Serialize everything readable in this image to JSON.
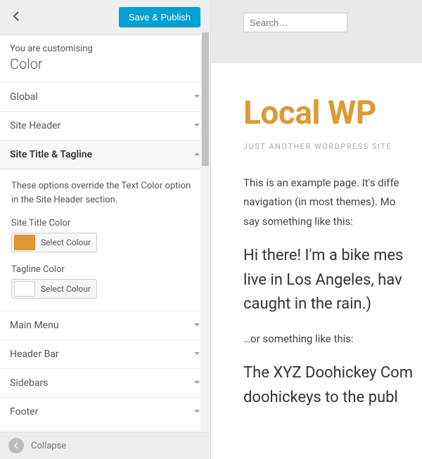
{
  "header": {
    "save_label": "Save & Publish"
  },
  "intro": {
    "line1": "You are customising",
    "line2": "Color"
  },
  "sections": {
    "global": "Global",
    "site_header": "Site Header",
    "title_tagline": "Site Title & Tagline",
    "main_menu": "Main Menu",
    "header_bar": "Header Bar",
    "sidebars": "Sidebars",
    "footer": "Footer"
  },
  "title_tagline_panel": {
    "description": "These options override the Text Color option in the Site Header section.",
    "site_title_color_label": "Site Title Color",
    "tagline_color_label": "Tagline Color",
    "select_color_label": "Select Colour",
    "site_title_color_value": "#dd9933"
  },
  "footer": {
    "collapse": "Collapse"
  },
  "preview": {
    "search_placeholder": "Search…",
    "site_title": "Local WP",
    "tagline": "JUST ANOTHER WORDPRESS SITE",
    "p1": "This is an example page. It's diffe",
    "p2": "navigation (in most themes). Mo",
    "p3": "say something like this:",
    "b1": "Hi there! I'm a bike mes",
    "b2": "live in Los Angeles, hav",
    "b3": "caught in the rain.)",
    "p4": "…or something like this:",
    "b4": "The XYZ Doohickey Com",
    "b5": "doohickeys to the publ"
  }
}
